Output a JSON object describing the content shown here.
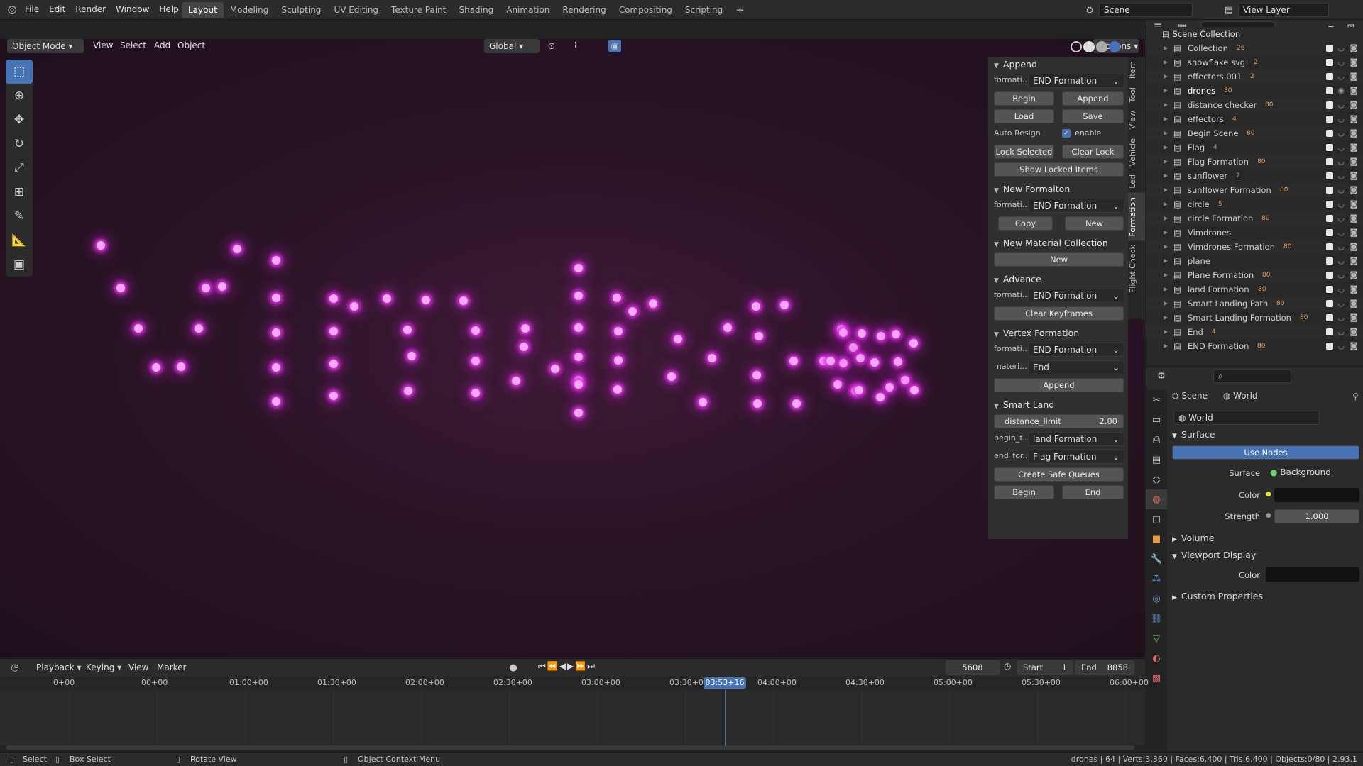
{
  "menu": {
    "items": [
      "File",
      "Edit",
      "Render",
      "Window",
      "Help"
    ]
  },
  "workspaces": [
    "Layout",
    "Modeling",
    "Sculpting",
    "UV Editing",
    "Texture Paint",
    "Shading",
    "Animation",
    "Rendering",
    "Compositing",
    "Scripting"
  ],
  "scene": {
    "name": "Scene",
    "view_layer": "View Layer"
  },
  "viewport_header": {
    "mode": "Object Mode",
    "menus": [
      "View",
      "Select",
      "Add",
      "Object"
    ],
    "orientation": "Global",
    "options": "Options"
  },
  "npanel": {
    "tabs": [
      "Item",
      "Tool",
      "View",
      "Vehicle",
      "Led",
      "Formation",
      "Flight Check"
    ],
    "append": {
      "title": "Append",
      "formation_label": "formati...",
      "formation_value": "END Formation",
      "begin": "Begin",
      "append": "Append",
      "load": "Load",
      "save": "Save",
      "auto_resign": "Auto Resign",
      "enable": "enable",
      "lock_selected": "Lock Selected",
      "clear_lock": "Clear Lock",
      "show_locked": "Show Locked Items"
    },
    "new_formation": {
      "title": "New Formaiton",
      "formation_label": "formati...",
      "formation_value": "END Formation",
      "copy": "Copy",
      "new": "New"
    },
    "new_material": {
      "title": "New Material Collection",
      "new": "New"
    },
    "advance": {
      "title": "Advance",
      "formation_label": "formati...",
      "formation_value": "END Formation",
      "clear_keyframes": "Clear Keyframes"
    },
    "vertex_formation": {
      "title": "Vertex Formation",
      "formation_label": "formati...",
      "formation_value": "END Formation",
      "material_label": "materi...",
      "material_value": "End",
      "append": "Append"
    },
    "smart_land": {
      "title": "Smart Land",
      "distance_label": "distance_limit",
      "distance_value": "2.00",
      "begin_label": "begin_f...",
      "begin_value": "land Formation",
      "end_label": "end_for...",
      "end_value": "Flag Formation",
      "create_queues": "Create Safe Queues",
      "begin": "Begin",
      "end": "End"
    }
  },
  "outliner": {
    "root": "Scene Collection",
    "items": [
      {
        "name": "Collection",
        "badge": "26"
      },
      {
        "name": "snowflake.svg",
        "badge": "2"
      },
      {
        "name": "effectors.001",
        "badge": "2"
      },
      {
        "name": "drones",
        "badge": "80"
      },
      {
        "name": "distance checker",
        "badge": "80"
      },
      {
        "name": "effectors",
        "badge": "4"
      },
      {
        "name": "Begin Scene",
        "badge": "80"
      },
      {
        "name": "Flag",
        "badge": "4"
      },
      {
        "name": "Flag Formation",
        "badge": "80"
      },
      {
        "name": "sunflower",
        "badge": "2"
      },
      {
        "name": "sunflower Formation",
        "badge": "80"
      },
      {
        "name": "circle",
        "badge": "5"
      },
      {
        "name": "circle Formation",
        "badge": "80"
      },
      {
        "name": "Vimdrones",
        "badge": ""
      },
      {
        "name": "Vimdrones Formation",
        "badge": "80"
      },
      {
        "name": "plane",
        "badge": ""
      },
      {
        "name": "Plane Formation",
        "badge": "80"
      },
      {
        "name": "land Formation",
        "badge": "80"
      },
      {
        "name": "Smart Landing Path",
        "badge": "80"
      },
      {
        "name": "Smart Landing Formation",
        "badge": "80"
      },
      {
        "name": "End",
        "badge": "4"
      },
      {
        "name": "END Formation",
        "badge": "80"
      }
    ]
  },
  "properties": {
    "breadcrumb_scene": "Scene",
    "breadcrumb_world": "World",
    "world_name": "World",
    "surface_title": "Surface",
    "use_nodes": "Use Nodes",
    "surface_label": "Surface",
    "surface_value": "Background",
    "color_label": "Color",
    "strength_label": "Strength",
    "strength_value": "1.000",
    "volume": "Volume",
    "viewport_display": "Viewport Display",
    "vd_color_label": "Color",
    "custom_props": "Custom Properties"
  },
  "timeline": {
    "menus": [
      "Playback",
      "Keying",
      "View",
      "Marker"
    ],
    "current_frame": "5608",
    "start_label": "Start",
    "start_value": "1",
    "end_label": "End",
    "end_value": "8858",
    "ticks": [
      "0+00",
      "00+00",
      "01:00+00",
      "01:30+00",
      "02:00+00",
      "02:30+00",
      "03:00+00",
      "03:30+00",
      "04:00+00",
      "04:30+00",
      "05:00+00",
      "05:30+00",
      "06:00+00"
    ],
    "current_time": "03:53+16",
    "playhead_fraction": 0.633
  },
  "statusbar": {
    "select": "Select",
    "box_select": "Box Select",
    "rotate_view": "Rotate View",
    "context_menu": "Object Context Menu",
    "stats": "drones | 64 | Verts:3,360 | Faces:6,400 | Tris:6,400 | Objects:0/80 | 2.93.1"
  },
  "colors": {
    "accent": "#4772b3",
    "drone_glow": "#e032e6"
  }
}
